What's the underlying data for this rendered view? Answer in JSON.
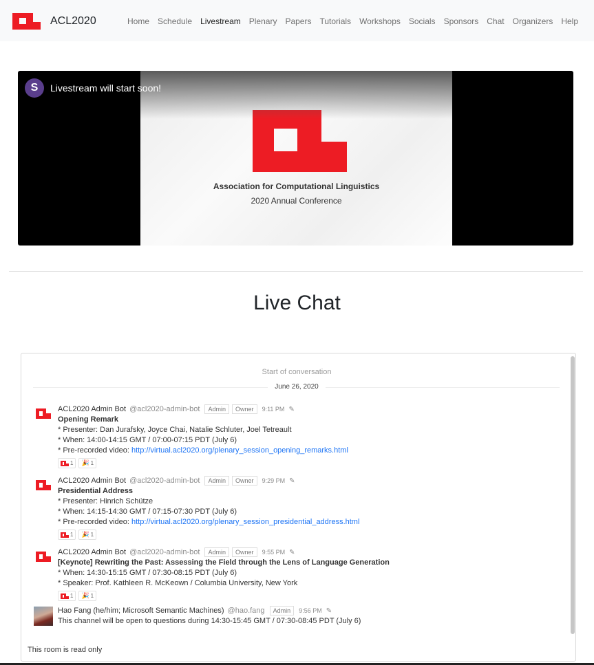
{
  "app": {
    "brand": "ACL2020",
    "nav": [
      "Home",
      "Schedule",
      "Livestream",
      "Plenary",
      "Papers",
      "Tutorials",
      "Workshops",
      "Socials",
      "Sponsors",
      "Chat",
      "Organizers",
      "Help"
    ],
    "active_nav": "Livestream",
    "brand_color": "#ed1c24"
  },
  "video": {
    "channel_initial": "S",
    "title": "Livestream will start soon!",
    "org": "Association for Computational Linguistics",
    "subtitle": "2020 Annual Conference"
  },
  "section": {
    "title": "Live Chat"
  },
  "chat": {
    "start_label": "Start of conversation",
    "date": "June 26, 2020",
    "read_only": "This room is read only",
    "messages": [
      {
        "name": "ACL2020 Admin Bot",
        "username": "@acl2020-admin-bot",
        "tags": [
          "Admin",
          "Owner"
        ],
        "time": "9:11 PM",
        "title": "Opening Remark",
        "lines": [
          "* Presenter: Dan Jurafsky, Joyce Chai, Natalie Schluter, Joel Tetreault",
          "* When: 14:00-14:15 GMT / 07:00-07:15 PDT (July 6)"
        ],
        "link_prefix": "* Pre-recorded video: ",
        "link": "http://virtual.acl2020.org/plenary_session_opening_remarks.html",
        "reactions": [
          "1",
          "1"
        ]
      },
      {
        "name": "ACL2020 Admin Bot",
        "username": "@acl2020-admin-bot",
        "tags": [
          "Admin",
          "Owner"
        ],
        "time": "9:29 PM",
        "title": "Presidential Address",
        "lines": [
          "* Presenter: Hinrich Schütze",
          "* When: 14:15-14:30 GMT / 07:15-07:30 PDT (July 6)"
        ],
        "link_prefix": "* Pre-recorded video: ",
        "link": "http://virtual.acl2020.org/plenary_session_presidential_address.html",
        "reactions": [
          "1",
          "1"
        ]
      },
      {
        "name": "ACL2020 Admin Bot",
        "username": "@acl2020-admin-bot",
        "tags": [
          "Admin",
          "Owner"
        ],
        "time": "9:55 PM",
        "title": "[Keynote] Rewriting the Past: Assessing the Field through the Lens of Language Generation",
        "lines": [
          "* When: 14:30-15:15 GMT / 07:30-08:15 PDT (July 6)",
          "* Speaker: Prof. Kathleen R. McKeown / Columbia University, New York"
        ],
        "reactions": [
          "1",
          "1"
        ]
      },
      {
        "name": "Hao Fang (he/him; Microsoft Semantic Machines)",
        "username": "@hao.fang",
        "tags": [
          "Admin"
        ],
        "time": "9:56 PM",
        "lines": [
          "This channel will be open to questions during 14:30-15:45 GMT / 07:30-08:45 PDT (July 6)"
        ]
      }
    ]
  }
}
